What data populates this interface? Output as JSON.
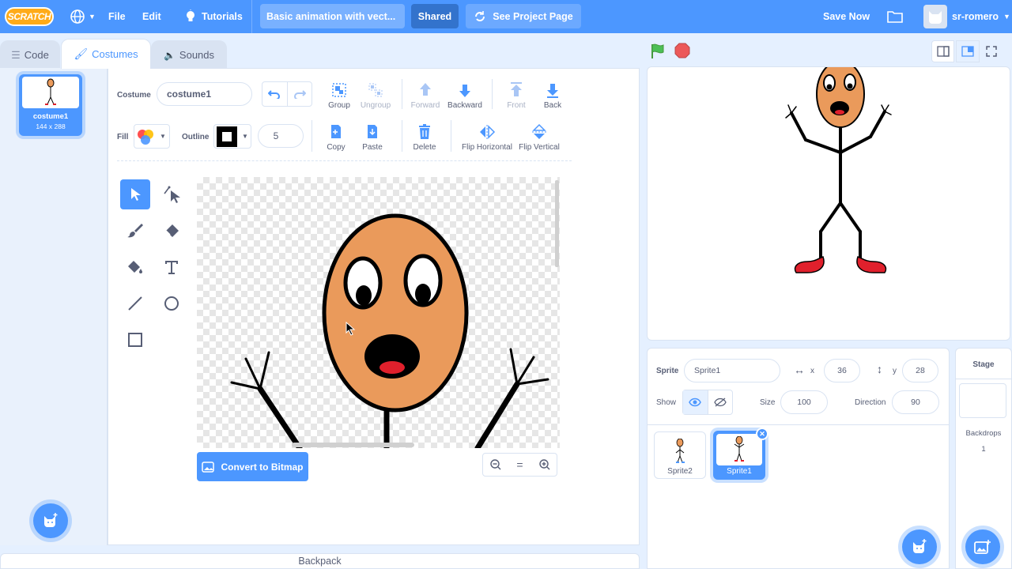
{
  "menubar": {
    "logo": "SCRATCH",
    "file": "File",
    "edit": "Edit",
    "tutorials": "Tutorials",
    "project_title": "Basic animation with vect...",
    "shared": "Shared",
    "see_project": "See Project Page",
    "save_now": "Save Now",
    "username": "sr-romero"
  },
  "tabs": [
    {
      "label": "Code",
      "icon": "code-icon"
    },
    {
      "label": "Costumes",
      "icon": "brush-icon"
    },
    {
      "label": "Sounds",
      "icon": "speaker-icon"
    }
  ],
  "costume_list": [
    {
      "index": "1",
      "name": "costume1",
      "size": "144 x 288"
    }
  ],
  "paint_editor": {
    "costume_label": "Costume",
    "costume_name": "costume1",
    "fill_label": "Fill",
    "outline_label": "Outline",
    "outline_width": "5",
    "buttons": {
      "group": "Group",
      "ungroup": "Ungroup",
      "forward": "Forward",
      "backward": "Backward",
      "front": "Front",
      "back": "Back",
      "copy": "Copy",
      "paste": "Paste",
      "delete": "Delete",
      "flip_horizontal": "Flip Horizontal",
      "flip_vertical": "Flip Vertical"
    },
    "convert_button": "Convert to Bitmap",
    "zoom_reset": "="
  },
  "sprite_info": {
    "sprite_label": "Sprite",
    "sprite_name": "Sprite1",
    "x_label": "x",
    "x": "36",
    "y_label": "y",
    "y": "28",
    "show_label": "Show",
    "size_label": "Size",
    "size": "100",
    "direction_label": "Direction",
    "direction": "90"
  },
  "sprites": [
    {
      "name": "Sprite2",
      "selected": false
    },
    {
      "name": "Sprite1",
      "selected": true
    }
  ],
  "stage_panel": {
    "title": "Stage",
    "backdrops_label": "Backdrops",
    "backdrops_count": "1"
  },
  "backpack": "Backpack",
  "colors": {
    "accent": "#4c97ff",
    "menubar": "#4c97ff",
    "face": "#ea9a5b",
    "shoe": "#e0202c",
    "mouth_tongue": "#e0202c",
    "flag": "#4cbf56",
    "stop": "#ec5959"
  }
}
